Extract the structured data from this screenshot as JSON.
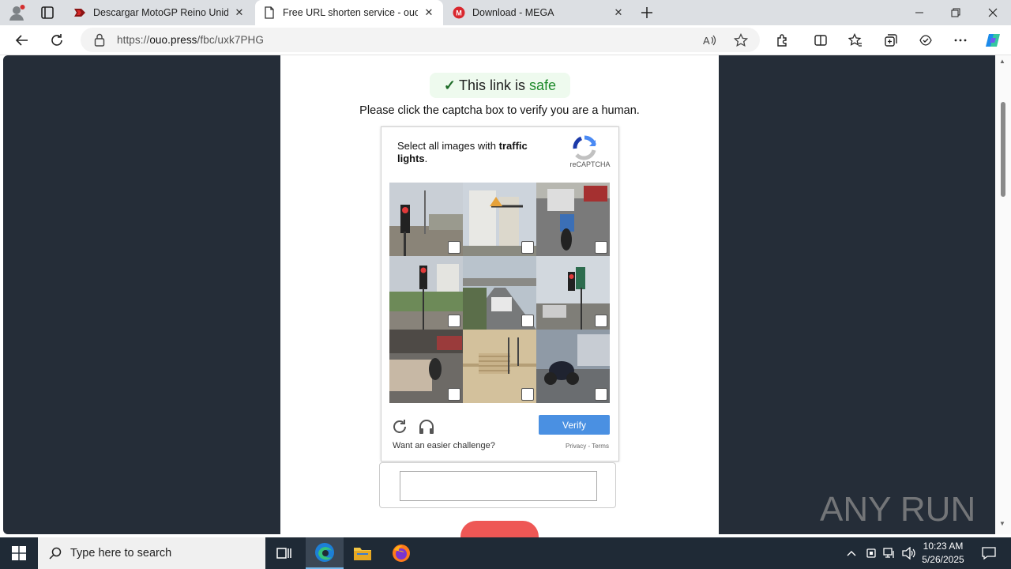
{
  "browser": {
    "tabs": [
      {
        "title": "Descargar MotoGP Reino Unido",
        "active": false
      },
      {
        "title": "Free URL shorten service - ouo.press",
        "active": true
      },
      {
        "title": "Download - MEGA",
        "active": false
      }
    ],
    "url_prefix": "https://",
    "url_host": "ouo.press",
    "url_path": "/fbc/uxk7PHG"
  },
  "page": {
    "safe_check": "✓",
    "safe_text_1": "This link is ",
    "safe_text_2": "safe",
    "instruction": "Please click the captcha box to verify you are a human.",
    "captcha": {
      "prompt_prefix": "Select all images with ",
      "prompt_target": "traffic lights",
      "prompt_suffix": ".",
      "brand": "reCAPTCHA",
      "verify_label": "Verify",
      "easier_label": "Want an easier challenge?",
      "privacy_label": "Privacy - Terms"
    },
    "text_input_value": "",
    "watermark": "ANY RUN"
  },
  "taskbar": {
    "search_placeholder": "Type here to search",
    "time": "10:23 AM",
    "date": "5/26/2025"
  },
  "colors": {
    "page_dark": "#252d38",
    "verify_blue": "#4a90e2",
    "safe_green": "#1d8a2a",
    "red_button": "#ee5755",
    "taskbar": "#1f2a36"
  }
}
